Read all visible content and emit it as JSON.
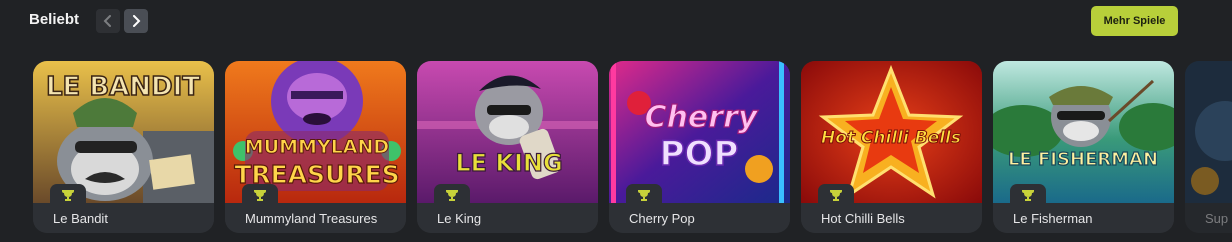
{
  "section": {
    "title": "Beliebt",
    "more_label": "Mehr Spiele"
  },
  "colors": {
    "background": "#202225",
    "card": "#2d3035",
    "accent": "#b8cf3a",
    "trophy": "#c8d23a"
  },
  "games": [
    {
      "name": "Le Bandit",
      "logo": "LE BANDIT"
    },
    {
      "name": "Mummyland Treasures",
      "logo_line1": "MUMMYLAND",
      "logo_line2": "TREASURES"
    },
    {
      "name": "Le King",
      "logo": "LE KING"
    },
    {
      "name": "Cherry Pop",
      "logo_line1": "Cherry",
      "logo_line2": "POP"
    },
    {
      "name": "Hot Chilli Bells",
      "logo": "Hot Chilli Bells"
    },
    {
      "name": "Le Fisherman",
      "logo": "LE FISHERMAN"
    },
    {
      "name": "Sup"
    }
  ]
}
